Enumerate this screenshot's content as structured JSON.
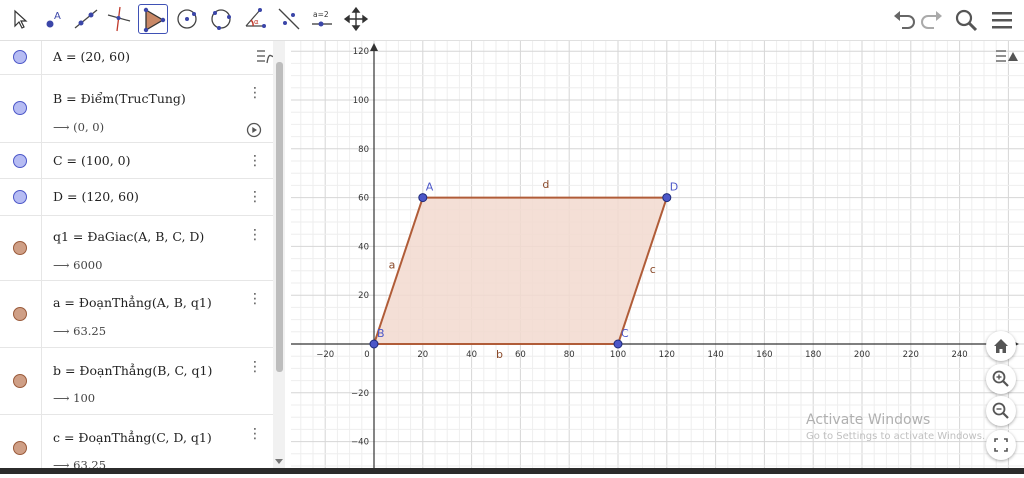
{
  "toolbar": {
    "tools": [
      "move-tool",
      "point-tool",
      "line-tool",
      "perpendicular-line-tool",
      "polygon-tool",
      "circle-center-point-tool",
      "circle-three-points-tool",
      "angle-tool",
      "reflect-line-tool",
      "slider-tool",
      "move-graphics-view-tool"
    ],
    "slider_label": "a=2"
  },
  "algebra": {
    "rows": [
      {
        "color": "blue",
        "def": "A = (20, 60)",
        "value": ""
      },
      {
        "color": "blue",
        "def": "B = Điểm(TrucTung)",
        "value": "⟶ (0, 0)"
      },
      {
        "color": "blue",
        "def": "C = (100, 0)",
        "value": ""
      },
      {
        "color": "blue",
        "def": "D = (120, 60)",
        "value": ""
      },
      {
        "color": "brown",
        "def": "q1 = ĐaGiac(A, B, C, D)",
        "value": "⟶ 6000"
      },
      {
        "color": "brown",
        "def": "a = ĐoạnThẳng(A, B, q1)",
        "value": "⟶ 63.25"
      },
      {
        "color": "brown",
        "def": "b = ĐoạnThẳng(B, C, q1)",
        "value": "⟶ 100"
      },
      {
        "color": "brown",
        "def": "c = ĐoạnThẳng(C, D, q1)",
        "value": "⟶ 63.25"
      }
    ]
  },
  "graphics": {
    "x_ticks": [
      "−20",
      "0",
      "20",
      "40",
      "60",
      "80",
      "100",
      "120",
      "140",
      "160",
      "180",
      "200",
      "220",
      "240"
    ],
    "y_ticks": [
      "120",
      "100",
      "80",
      "60",
      "40",
      "20",
      "−20",
      "−40"
    ],
    "points": {
      "A": "A",
      "B": "B",
      "C": "C",
      "D": "D"
    },
    "segments": {
      "a": "a",
      "b": "b",
      "c": "c",
      "d": "d"
    },
    "colors": {
      "point": "#4c57c8",
      "polygon_fill": "#f2d9cf",
      "polygon_stroke": "#b05c38",
      "grid_minor": "#eeeeee",
      "grid_major": "#d6d6d6"
    }
  },
  "watermark": {
    "title": "Activate Windows",
    "subtitle": "Go to Settings to activate Windows."
  }
}
